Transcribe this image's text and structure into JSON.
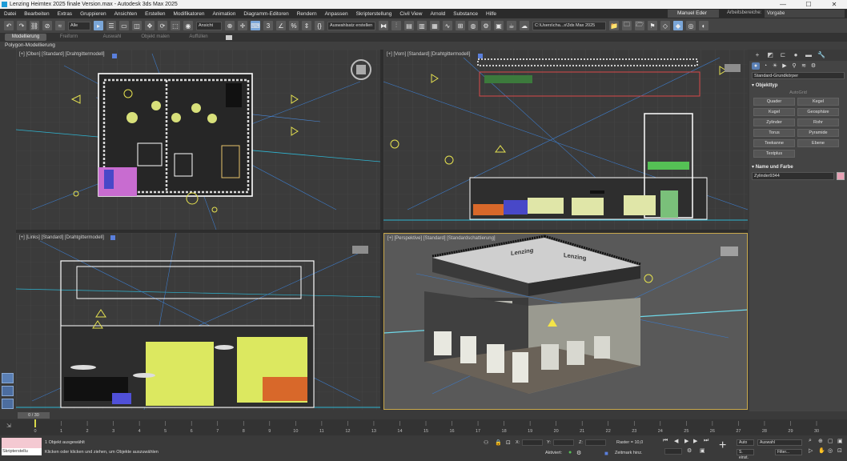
{
  "window": {
    "title": "Lenzing Heimtex 2025 finale Version.max - Autodesk 3ds Max 2025",
    "controls": [
      "—",
      "☐",
      "✕"
    ]
  },
  "menu": {
    "items": [
      "Datei",
      "Bearbeiten",
      "Extras",
      "Gruppieren",
      "Ansichten",
      "Erstellen",
      "Modifikatoren",
      "Animation",
      "Diagramm-Editoren",
      "Rendern",
      "Anpassen",
      "Skripterstellung",
      "Civil View",
      "Arnold",
      "Substance",
      "Hilfe"
    ],
    "user": "Manuel Eder",
    "workspace_label": "Arbeitsbereiche:",
    "workspace_value": "Vorgabe"
  },
  "toolbar": {
    "filter_select": "Alle",
    "refcoord_select": "Ansicht",
    "selection_set": "Auswahlsatz erstellen",
    "project_path": "C:\\Users\\cha...s\\3ds Max 2025"
  },
  "ribbon": {
    "tabs": [
      "Modellierung",
      "Freiform",
      "Auswahl",
      "Objekt malen",
      "Auffüllen"
    ],
    "subtitle": "Polygon-Modellierung"
  },
  "viewports": {
    "top_left": "[+] [Oben] [Standard] [Drahtgittermodell]",
    "top_right": "[+] [Vorn] [Standard] [Drahtgittermodell]",
    "bottom_left": "[+] [Links] [Standard] [Drahtgittermodell]",
    "bottom_right": "[+] [Perspektive] [Standard] [Standardschattierung]",
    "sign_text": "Lenzing"
  },
  "command_panel": {
    "dropdown": "Standard-Grundkörper",
    "object_type_title": "Objekttyp",
    "autogrid_hint": "AutoGrid",
    "buttons": [
      "Quader",
      "Kegel",
      "Kugel",
      "Geosphäre",
      "Zylinder",
      "Rohr",
      "Torus",
      "Pyramide",
      "Teekanne",
      "Ebene",
      "Textplus"
    ],
    "name_color_title": "Name und Farbe",
    "name_value": "Zylinder9344",
    "swatch_color": "#e8a1b5"
  },
  "timeline": {
    "frame_indicator": "0 / 30",
    "ticks": [
      "0",
      "1",
      "2",
      "3",
      "4",
      "5",
      "6",
      "7",
      "8",
      "9",
      "10",
      "11",
      "12",
      "13",
      "14",
      "15",
      "16",
      "17",
      "18",
      "19",
      "20",
      "21",
      "22",
      "23",
      "24",
      "25",
      "26",
      "27",
      "28",
      "29",
      "30"
    ]
  },
  "status": {
    "maxscript_label": "Skripterstellu",
    "selection_info": "1 Objekt ausgewählt",
    "prompt": "Klicken oder klicken und ziehen, um Objekte auszuwählen",
    "x_label": "X:",
    "y_label": "Y:",
    "z_label": "Z:",
    "grid": "Raster = 10,0",
    "add_time_tag": "Zeitmark hinz.",
    "auto_key": "Auto",
    "auto_select": "Auswahl",
    "set_key": "S. einst.",
    "filter_btn": "Filter...",
    "activated": "Aktiviert:"
  }
}
